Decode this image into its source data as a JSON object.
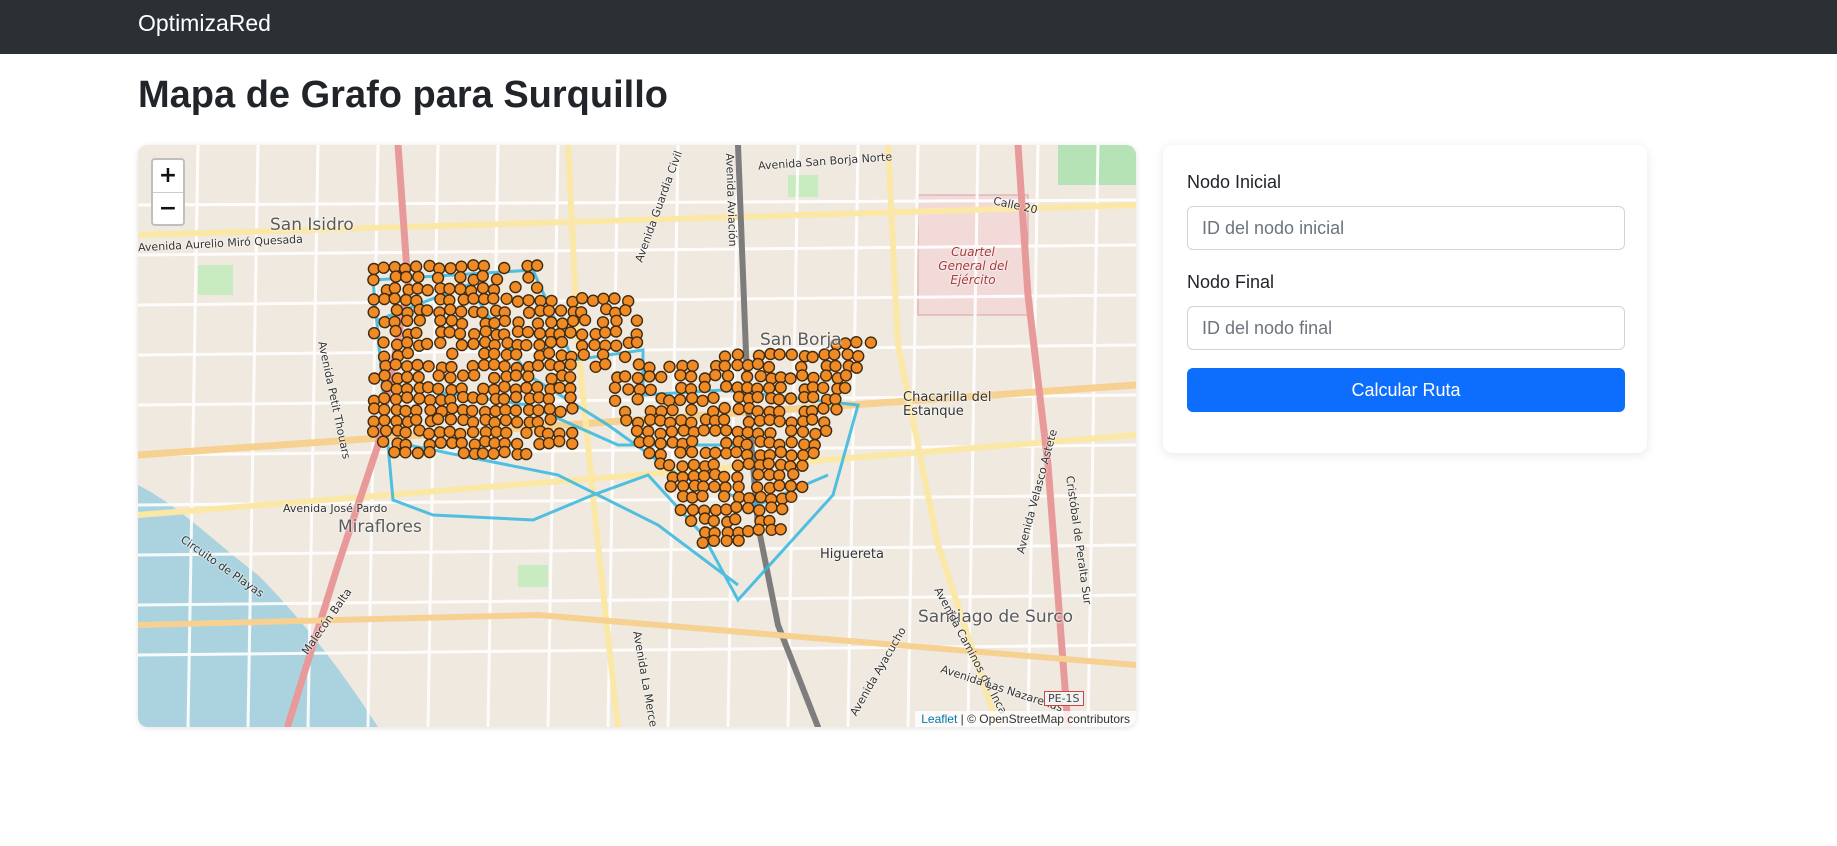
{
  "navbar": {
    "brand": "OptimizaRed"
  },
  "page": {
    "title": "Mapa de Grafo para Surquillo"
  },
  "map": {
    "zoom_in": "+",
    "zoom_out": "−",
    "attribution": {
      "leaflet": "Leaflet",
      "separator": " | © OpenStreetMap contributors"
    },
    "districts": [
      "San Isidro",
      "San Borja",
      "Miraflores",
      "Santiago de Surco",
      "Chacarilla del Estanque",
      "Higuereta"
    ],
    "streets": [
      "Avenida San Borja Norte",
      "Avenida Aurelio Miró Quesada",
      "Avenida Petit Thouars",
      "Avenida José Pardo",
      "Malecón Balta",
      "Circuito de Playas",
      "Avenida La Merced",
      "Avenida Ayacucho",
      "Avenida Caminos del Inca",
      "Avenida Velasco Astete",
      "Cristóbal de Peralta Sur",
      "Avenida Las Nazarenas",
      "Calle 20",
      "Avenida Guardia Civil",
      "Avenida Aviación"
    ],
    "military": "Cuartel General del Ejército",
    "route_badge": "PE-1S",
    "colors": {
      "node_fill": "#f08a24",
      "node_stroke": "#3d2a12",
      "edge": "#35b8e0"
    }
  },
  "form": {
    "start_label": "Nodo Inicial",
    "start_placeholder": "ID del nodo inicial",
    "start_value": "",
    "end_label": "Nodo Final",
    "end_placeholder": "ID del nodo final",
    "end_value": "",
    "submit_label": "Calcular Ruta",
    "submit_color": "#0d6efd"
  }
}
